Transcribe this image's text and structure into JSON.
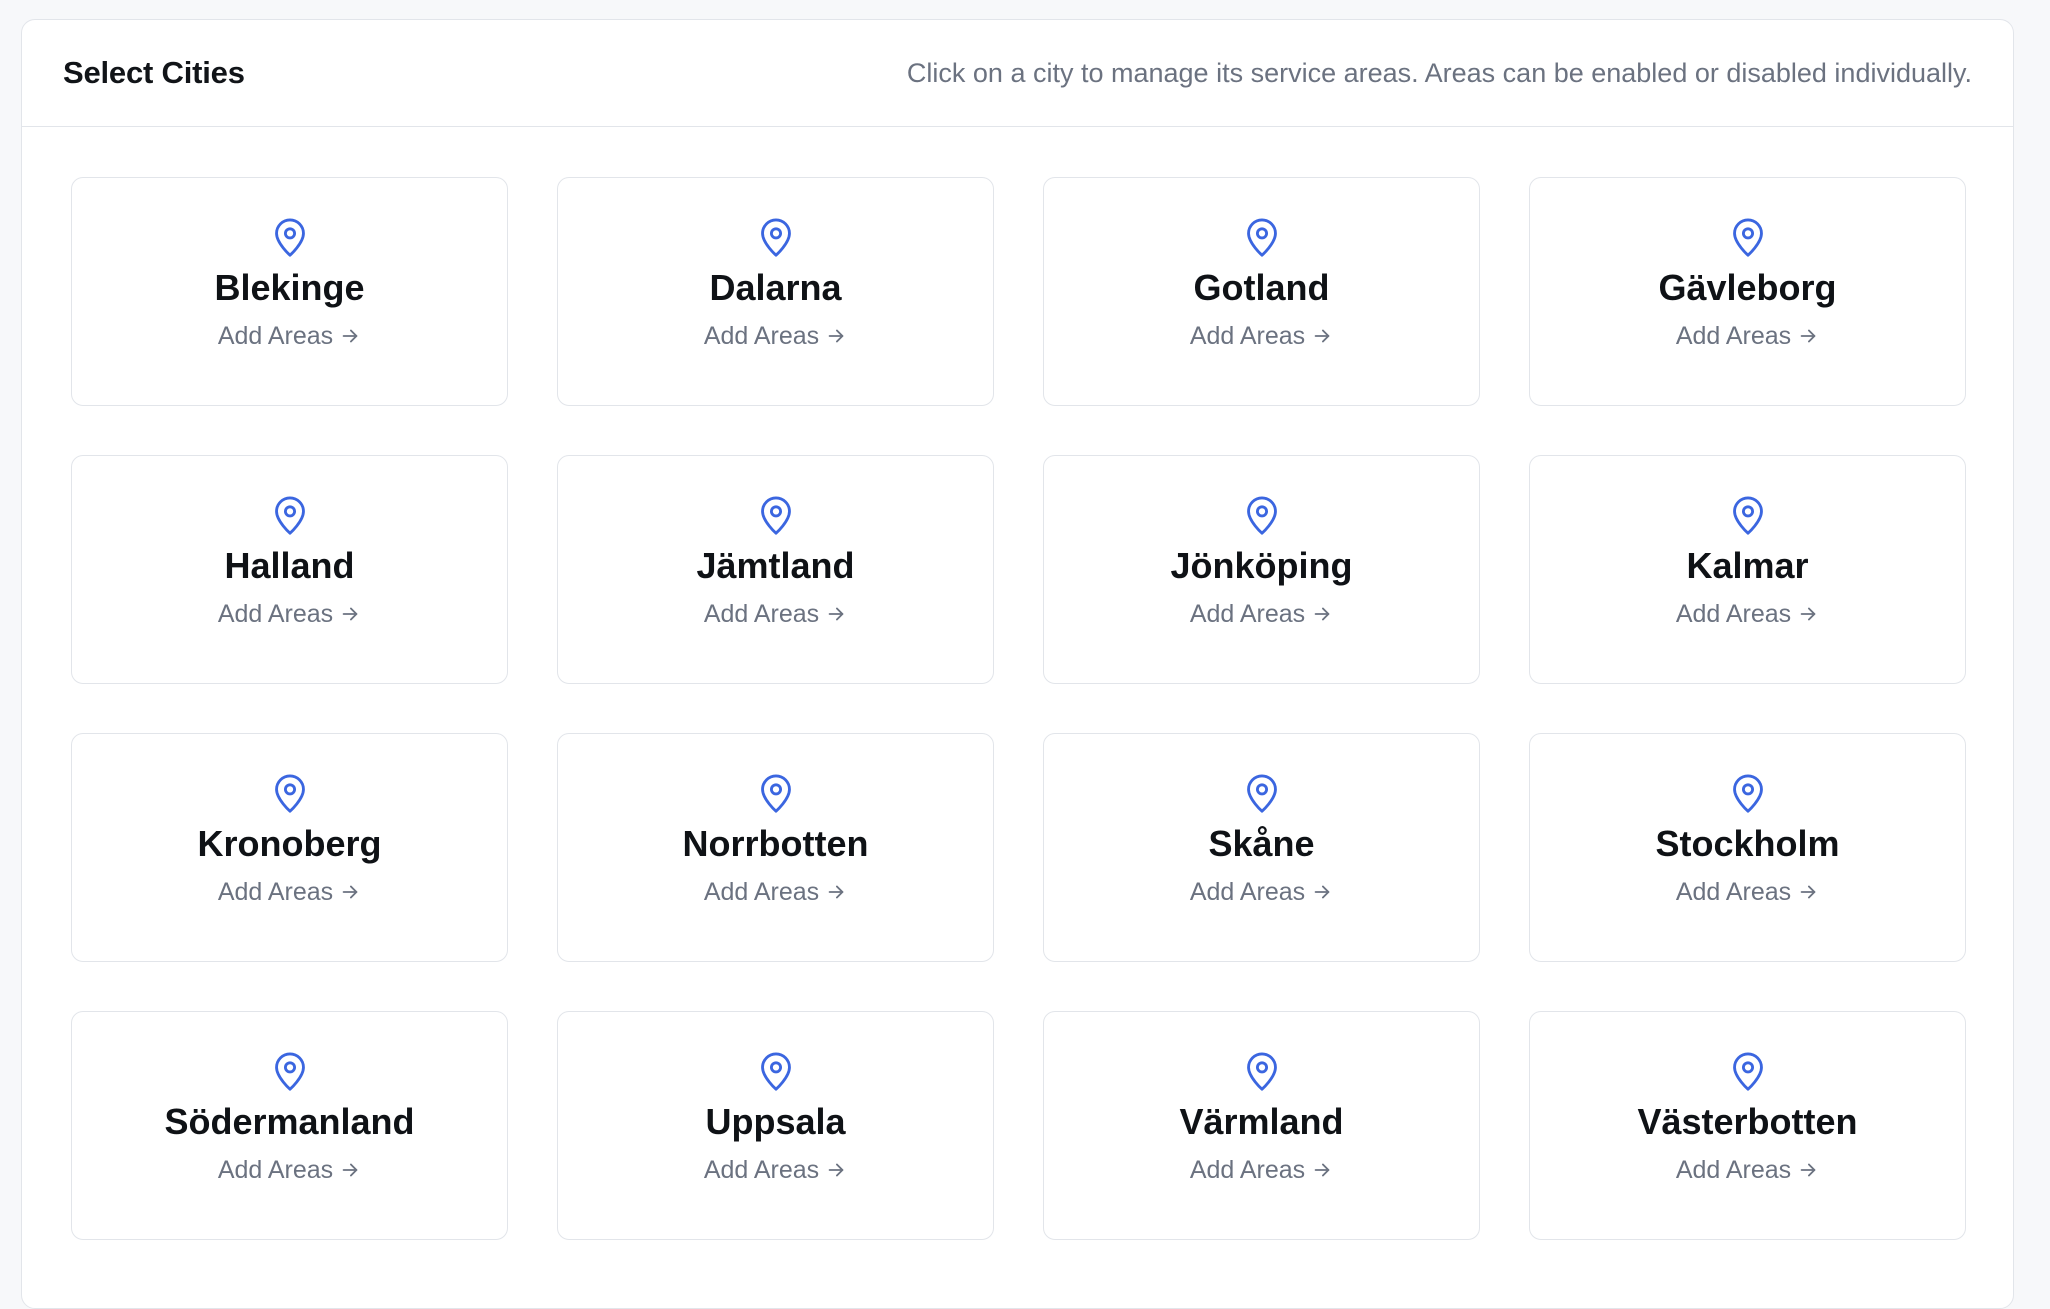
{
  "header": {
    "title": "Select Cities",
    "hint": "Click on a city to manage its service areas. Areas can be enabled or disabled individually."
  },
  "colors": {
    "accent": "#3b66e0",
    "muted_text": "#6b7280",
    "border": "#e2e5ea"
  },
  "icons": {
    "card_icon": "map-pin-icon",
    "link_icon": "arrow-right-icon"
  },
  "cities": [
    {
      "name": "Blekinge",
      "action": "Add Areas"
    },
    {
      "name": "Dalarna",
      "action": "Add Areas"
    },
    {
      "name": "Gotland",
      "action": "Add Areas"
    },
    {
      "name": "Gävleborg",
      "action": "Add Areas"
    },
    {
      "name": "Halland",
      "action": "Add Areas"
    },
    {
      "name": "Jämtland",
      "action": "Add Areas"
    },
    {
      "name": "Jönköping",
      "action": "Add Areas"
    },
    {
      "name": "Kalmar",
      "action": "Add Areas"
    },
    {
      "name": "Kronoberg",
      "action": "Add Areas"
    },
    {
      "name": "Norrbotten",
      "action": "Add Areas"
    },
    {
      "name": "Skåne",
      "action": "Add Areas"
    },
    {
      "name": "Stockholm",
      "action": "Add Areas"
    },
    {
      "name": "Södermanland",
      "action": "Add Areas"
    },
    {
      "name": "Uppsala",
      "action": "Add Areas"
    },
    {
      "name": "Värmland",
      "action": "Add Areas"
    },
    {
      "name": "Västerbotten",
      "action": "Add Areas"
    }
  ]
}
